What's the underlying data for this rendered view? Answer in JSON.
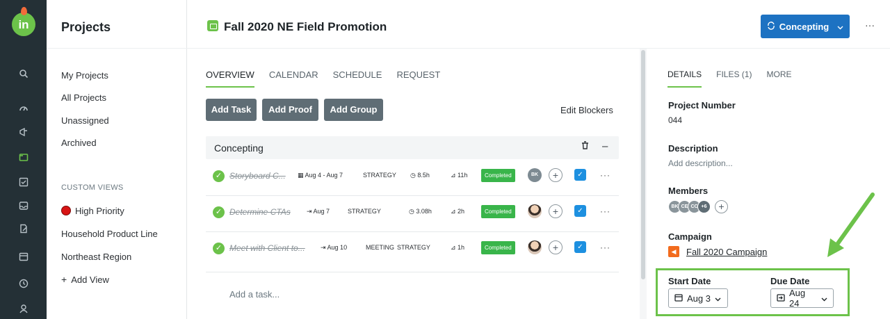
{
  "rail": {
    "icons": [
      "search-icon",
      "dashboard-icon",
      "campaign-icon",
      "projects-icon",
      "tasks-icon",
      "inbox-icon",
      "proof-icon",
      "calendar-icon",
      "time-icon",
      "user-icon"
    ]
  },
  "nav": {
    "title": "Projects",
    "items": [
      "My Projects",
      "All Projects",
      "Unassigned",
      "Archived"
    ],
    "custom_views_label": "CUSTOM VIEWS",
    "custom_views": [
      "High Priority",
      "Household Product Line",
      "Northeast Region"
    ],
    "add_view": "Add View"
  },
  "header": {
    "project_title": "Fall 2020 NE Field Promotion",
    "status_label": "Concepting",
    "more": "···"
  },
  "main": {
    "tabs": [
      "OVERVIEW",
      "CALENDAR",
      "SCHEDULE",
      "REQUEST"
    ],
    "buttons": [
      "Add Task",
      "Add Proof",
      "Add Group"
    ],
    "edit_blockers": "Edit Blockers",
    "group_name": "Concepting",
    "tasks": [
      {
        "name": "Storyboard C...",
        "date": "Aug 4 - Aug 7",
        "tags": [
          "STRATEGY"
        ],
        "time": "8.5h",
        "effort": "11h",
        "status": "Completed",
        "assignee": "BK"
      },
      {
        "name": "Determine CTAs",
        "date": "Aug 7",
        "tags": [
          "STRATEGY"
        ],
        "time": "3.08h",
        "effort": "2h",
        "status": "Completed",
        "assignee": ""
      },
      {
        "name": "Meet with Client to...",
        "date": "Aug 10",
        "tags": [
          "MEETING",
          "STRATEGY"
        ],
        "time": "",
        "effort": "1h",
        "status": "Completed",
        "assignee": ""
      }
    ],
    "add_task_placeholder": "Add a task..."
  },
  "details": {
    "tabs": [
      "DETAILS",
      "FILES (1)",
      "MORE"
    ],
    "project_number_label": "Project Number",
    "project_number": "044",
    "description_label": "Description",
    "description_placeholder": "Add description...",
    "members_label": "Members",
    "members": [
      "BK",
      "CE",
      "CC",
      "+6"
    ],
    "campaign_label": "Campaign",
    "campaign": "Fall 2020 Campaign",
    "start_date_label": "Start Date",
    "start_date": "Aug 3",
    "due_date_label": "Due Date",
    "due_date": "Aug 24"
  },
  "colors": {
    "accent_green": "#6cc24a",
    "status_blue": "#1d72c2",
    "completed_green": "#39b54a",
    "rail_dark": "#243036"
  }
}
